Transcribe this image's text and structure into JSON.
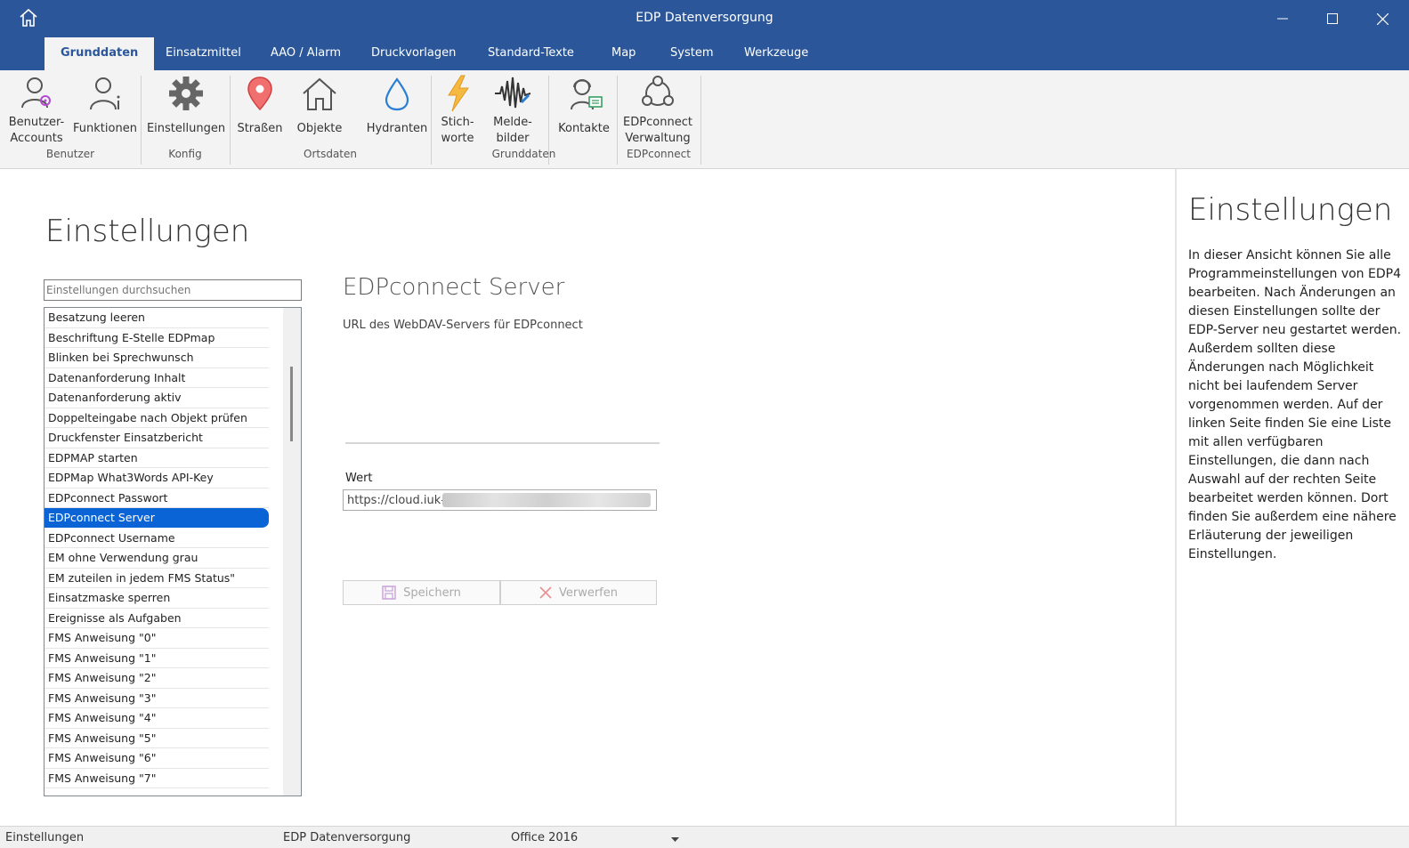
{
  "window": {
    "title": "EDP Datenversorgung"
  },
  "tabs": [
    "Grunddaten",
    "Einsatzmittel",
    "AAO / Alarm",
    "Druckvorlagen",
    "Standard-Texte",
    "Map",
    "System",
    "Werkzeuge"
  ],
  "ribbon": {
    "buttons": {
      "benutzer_accounts": [
        "Benutzer-",
        "Accounts"
      ],
      "funktionen": "Funktionen",
      "einstellungen": "Einstellungen",
      "strassen": "Straßen",
      "objekte": "Objekte",
      "hydranten": "Hydranten",
      "stichworte": [
        "Stich-",
        "worte"
      ],
      "meldebilder": [
        "Melde-",
        "bilder"
      ],
      "kontakte": "Kontakte",
      "edpconnect_verwaltung": [
        "EDPconnect",
        "Verwaltung"
      ]
    },
    "groups": {
      "benutzer": "Benutzer",
      "konfig": "Konfig",
      "ortsdaten": "Ortsdaten",
      "grunddaten": "Grunddaten",
      "edpconnect": "EDPconnect"
    }
  },
  "page": {
    "title": "Einstellungen",
    "search_placeholder": "Einstellungen durchsuchen"
  },
  "settings_list": [
    "Besatzung leeren",
    "Beschriftung E-Stelle EDPmap",
    "Blinken bei Sprechwunsch",
    "Datenanforderung Inhalt",
    "Datenanforderung aktiv",
    "Doppelteingabe nach Objekt prüfen",
    "Druckfenster Einsatzbericht",
    "EDPMAP starten",
    "EDPMap What3Words API-Key",
    "EDPconnect Passwort",
    "EDPconnect Server",
    "EDPconnect Username",
    "EM ohne Verwendung grau",
    "EM zuteilen in jedem FMS Status\"",
    "Einsatzmaske sperren",
    "Ereignisse als Aufgaben",
    "FMS Anweisung \"0\"",
    "FMS Anweisung \"1\"",
    "FMS Anweisung \"2\"",
    "FMS Anweisung \"3\"",
    "FMS Anweisung \"4\"",
    "FMS Anweisung \"5\"",
    "FMS Anweisung \"6\"",
    "FMS Anweisung \"7\""
  ],
  "selected_index": 10,
  "detail": {
    "title": "EDPconnect Server",
    "description": "URL des WebDAV-Servers für EDPconnect",
    "value_label": "Wert",
    "value": "https://cloud.iuk-h",
    "save_label": "Speichern",
    "discard_label": "Verwerfen"
  },
  "help": {
    "title": "Einstellungen",
    "text": "In dieser Ansicht können Sie alle Programmeinstellungen von EDP4 bearbeiten. Nach Änderungen an diesen Einstellungen sollte der EDP-Server neu gestartet werden. Außerdem sollten diese Änderungen nach Möglichkeit nicht bei laufendem Server vorgenommen werden. Auf der linken Seite finden Sie eine Liste mit allen verfügbaren Einstellungen, die dann nach Auswahl auf der rechten Seite bearbeitet werden können. Dort finden Sie außerdem eine nähere Erläuterung der jeweiligen Einstellungen."
  },
  "statusbar": {
    "view": "Einstellungen",
    "app": "EDP Datenversorgung",
    "theme": "Office 2016"
  },
  "colors": {
    "accent": "#2b579a",
    "selection": "#0a64d6",
    "ribbon_bg": "#f3f3f3"
  }
}
